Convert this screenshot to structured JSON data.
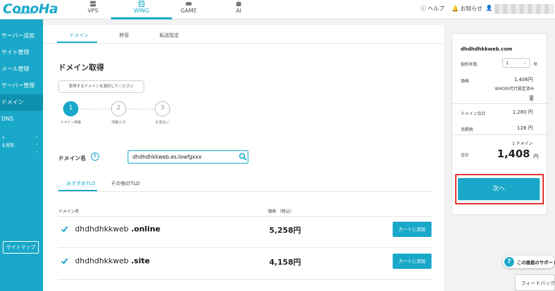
{
  "brand": {
    "logo_text": "ConoHa",
    "logo_sub": "by GMO",
    "accent": "#19a8c9"
  },
  "topnav": {
    "tabs": [
      {
        "label": "VPS",
        "icon": "server-icon"
      },
      {
        "label": "WING",
        "icon": "wing-icon",
        "active": true
      },
      {
        "label": "GAME",
        "icon": "gamepad-icon"
      },
      {
        "label": "AI",
        "icon": "robot-icon"
      }
    ],
    "help": "ヘルプ",
    "notifications": "お知らせ"
  },
  "sidebar": {
    "items": [
      "サーバー追加",
      "サイト管理",
      "メール管理",
      "サーバー管理",
      "ドメイン",
      "DNS"
    ],
    "active_index": 4,
    "small_items": [
      "ト",
      "る質問",
      ""
    ],
    "sitemap": "サイトマップ"
  },
  "subtabs": [
    "ドメイン",
    "移管",
    "転送設定"
  ],
  "page": {
    "title": "ドメイン取得",
    "tip": "取得するドメインを選択してください"
  },
  "steps": [
    {
      "num": "1",
      "label": "ドメイン検索",
      "active": true
    },
    {
      "num": "2",
      "label": "情報入力"
    },
    {
      "num": "3",
      "label": "お支払い"
    }
  ],
  "search": {
    "label": "ドメイン名",
    "help": "?",
    "value": "dhdhdhkkweb.es.lowfgxxx"
  },
  "tld_tabs": [
    "おすすめTLD",
    "その他のTLD"
  ],
  "table": {
    "headers": [
      "ドメイン名",
      "価格 （税込）"
    ],
    "rows": [
      {
        "name": "dhdhdhkkweb",
        "tld": ".online",
        "price": "5,258円",
        "action": "カートに追加"
      },
      {
        "name": "dhdhdhkkweb",
        "tld": ".site",
        "price": "4,158円",
        "action": "カートに追加"
      }
    ]
  },
  "summary": {
    "domain": "dhdhdhkkweb.com",
    "term_label": "契約年数",
    "term_value": "1",
    "term_unit": "年",
    "price_label": "価格",
    "price_value": "1,408円",
    "whois_note": "WHOIS代行設定済み",
    "domain_total_label": "ドメイン合計",
    "domain_total_value": "1,280 円",
    "tax_label": "消費税",
    "tax_value": "128 円",
    "count": "1 ドメイン",
    "total_label": "合計",
    "total_value": "1,408",
    "total_unit": "円",
    "next": "次へ"
  },
  "support": "この画面のサポート",
  "feedback": "フィードバック"
}
